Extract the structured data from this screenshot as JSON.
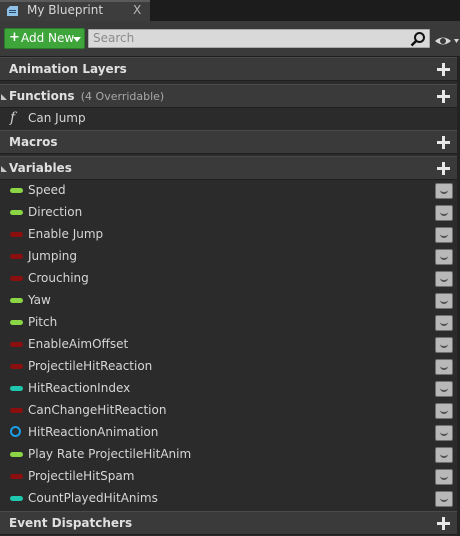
{
  "tab": {
    "title": "My Blueprint",
    "close": "X"
  },
  "toolbar": {
    "add_new_label": "Add New",
    "search_placeholder": "Search"
  },
  "sections": {
    "animation_layers": "Animation Layers",
    "functions": "Functions",
    "functions_sub": "(4 Overridable)",
    "macros": "Macros",
    "variables": "Variables",
    "event_dispatchers": "Event Dispatchers"
  },
  "functions": [
    {
      "label": "Can Jump",
      "icon": "function-icon"
    }
  ],
  "variables": [
    {
      "label": "Speed",
      "type_color": "#8bd644"
    },
    {
      "label": "Direction",
      "type_color": "#8bd644"
    },
    {
      "label": "Enable Jump",
      "type_color": "#8c0f0f"
    },
    {
      "label": "Jumping",
      "type_color": "#8c0f0f"
    },
    {
      "label": "Crouching",
      "type_color": "#8c0f0f"
    },
    {
      "label": "Yaw",
      "type_color": "#8bd644"
    },
    {
      "label": "Pitch",
      "type_color": "#8bd644"
    },
    {
      "label": "EnableAimOffset",
      "type_color": "#8c0f0f"
    },
    {
      "label": "ProjectileHitReaction",
      "type_color": "#8c0f0f"
    },
    {
      "label": "HitReactionIndex",
      "type_color": "#1ec7ad"
    },
    {
      "label": "CanChangeHitReaction",
      "type_color": "#8c0f0f"
    },
    {
      "label": "HitReactionAnimation",
      "type_color": "#1a9fe6",
      "shape": "ring"
    },
    {
      "label": "Play Rate ProjectileHitAnim",
      "type_color": "#8bd644"
    },
    {
      "label": "ProjectileHitSpam",
      "type_color": "#8c0f0f"
    },
    {
      "label": "CountPlayedHitAnims",
      "type_color": "#1ec7ad"
    }
  ]
}
